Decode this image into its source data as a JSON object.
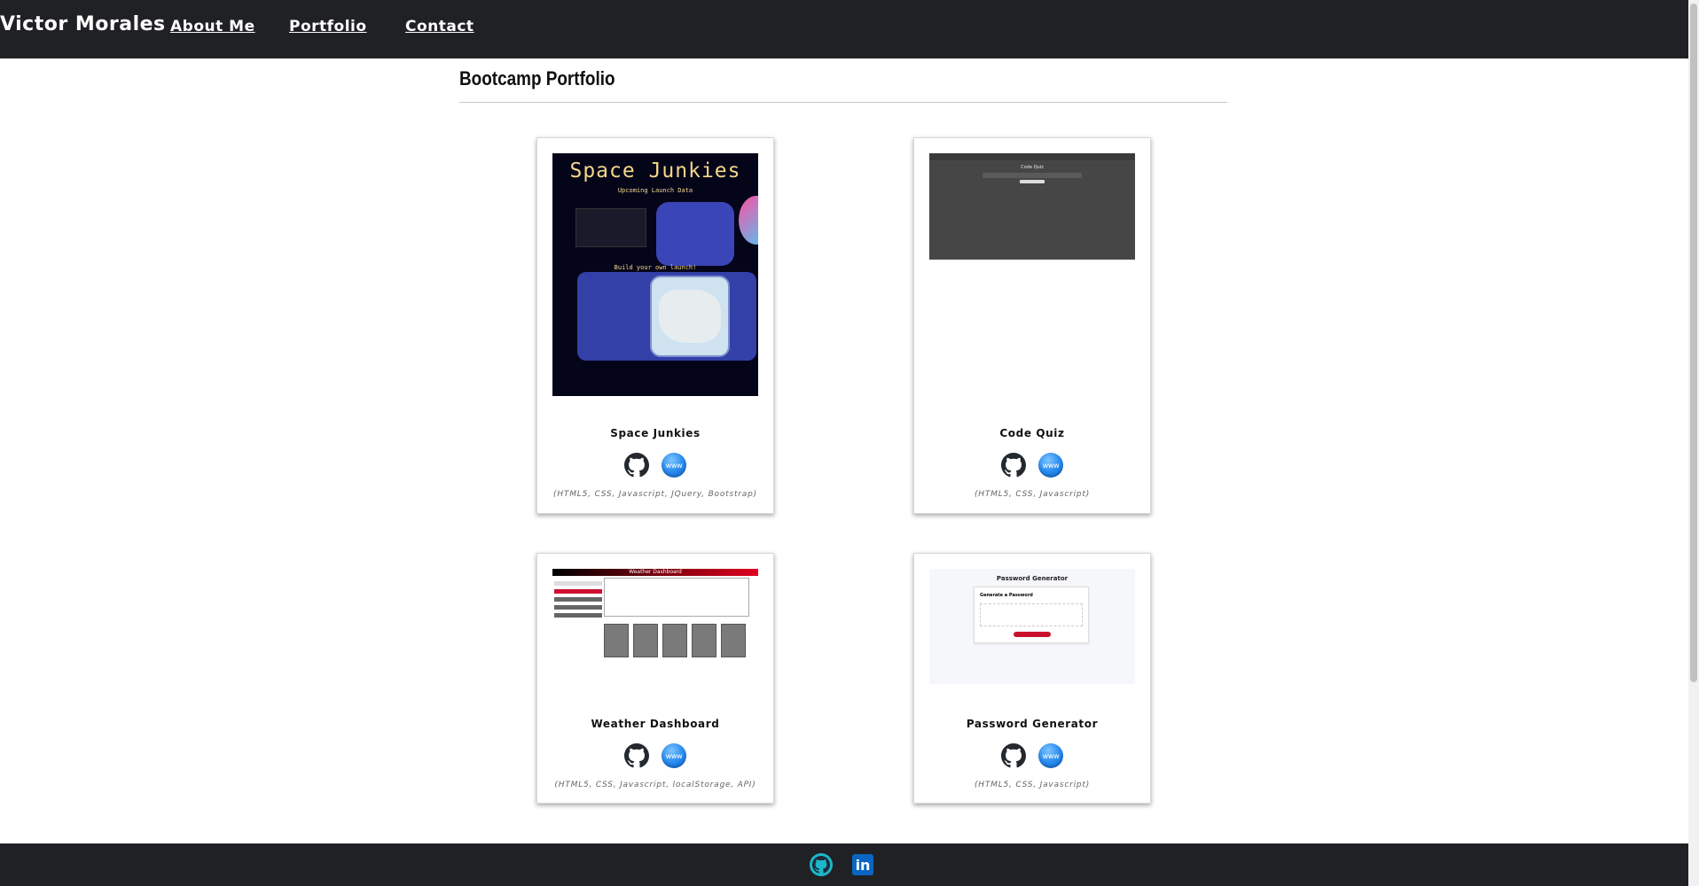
{
  "nav": {
    "brand": "Victor Morales",
    "links": [
      "About Me",
      "Portfolio",
      "Contact"
    ]
  },
  "section": {
    "title": "Bootcamp Portfolio"
  },
  "projects": [
    {
      "title": "Space Junkies",
      "tech": "(HTML5, CSS, Javascript, JQuery, Bootstrap)"
    },
    {
      "title": "Code Quiz",
      "tech": "(HTML5, CSS, Javascript)"
    },
    {
      "title": "Weather Dashboard",
      "tech": "(HTML5, CSS, Javascript, localStorage, API)"
    },
    {
      "title": "Password Generator",
      "tech": "(HTML5, CSS, Javascript)"
    }
  ],
  "thumbnails": {
    "space_junkies": {
      "title": "Space Junkies",
      "subtitle": "Upcoming Launch Data",
      "build": "Build your own launch!"
    },
    "code_quiz": {
      "title": "Code Quiz"
    },
    "weather_dashboard": {
      "title": "Weather Dashboard"
    },
    "password_generator": {
      "title": "Password Generator",
      "box_title": "Generate a Password"
    }
  },
  "icons": {
    "github": "github-icon",
    "website": "www-icon",
    "website_label": "www",
    "linkedin": "linkedin-icon",
    "linkedin_label": "in"
  },
  "colors": {
    "navbar": "#202124",
    "footer": "#202124",
    "www_blue": "#2a8cf0",
    "linkedin_blue": "#0a66c2",
    "github_footer": "#1bb7c9"
  }
}
